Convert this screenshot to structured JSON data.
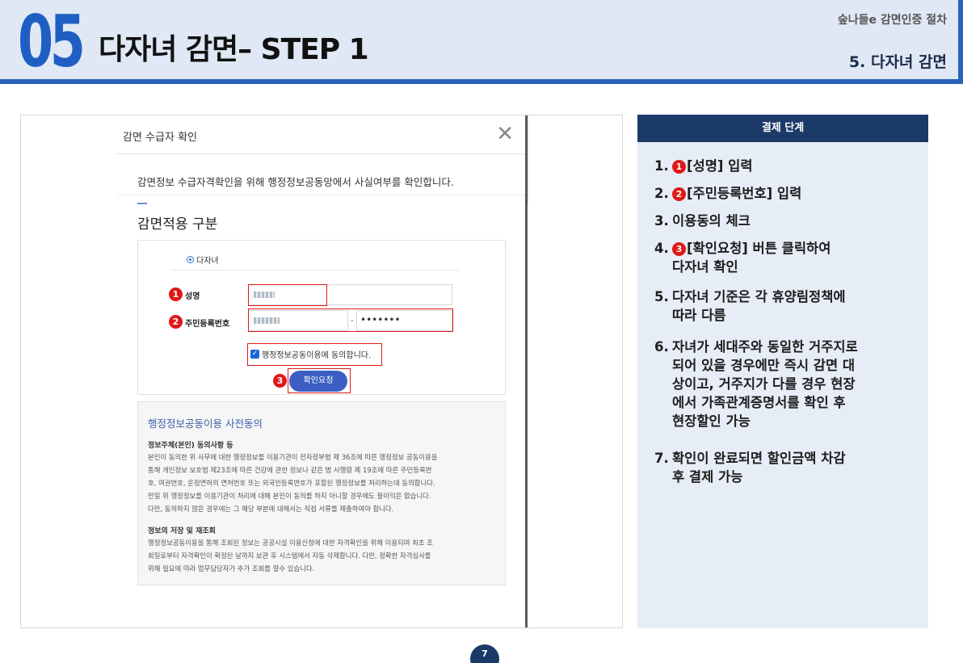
{
  "header": {
    "chapter_number": "05",
    "title": "다자녀 감면– STEP 1",
    "sub_title": "숲나들e 감면인증 절차",
    "section": "5. 다자녀 감면"
  },
  "modal": {
    "title": "감면 수급자 확인",
    "close_symbol": "✕",
    "description": "감면정보 수급자격확인을 위해 행정정보공동망에서 사실여부를 확인합니다.",
    "section_title": "감면적용 구분",
    "radio_option": "다자녀",
    "fields": {
      "name_label": "성명",
      "rrn_label": "주민등록번호",
      "rrn_separator": "-",
      "rrn_back": "•••••••"
    },
    "badges": [
      "1",
      "2",
      "3"
    ],
    "agree_label": "행정정보공동이용에 동의합니다.",
    "confirm_button": "확인요청",
    "consent": {
      "title": "행정정보공동이용 사전동의",
      "sub1": "정보주체(본인) 동의사항 등",
      "text1": "본인이 동의한 위 사무에 대한 행정정보를 이용기관이 전자정부법 제 36조에 따른 행정정보 공동이용을\n통해 개인정보 보호법 제23조에 따른 건강에 관한 정보나 같은 법 시행령 제 19조에 따른 주민등록번\n호, 여권번호, 운정면허의 면허번호 또는 외국인등록번호가 포함된 행정정보를 처리하는데 동의합니다.\n만일 위 행정정보를 이용기관이 처리에 대해 본인이 동의를 하지 아니할 경우에도 불이익은 없습니다.\n다만, 동의하지 않은 경우에는 그 해당 부분에 대해서는 직접 서류를 제출하여야 합니다.",
      "sub2": "정보의 저장 및 재조회",
      "text2": "행정정보공동이용을 통해 조회된 정보는 공공시설 이용신청에 대한 자격확인을 위해 이용되며 최초 조\n회일로부터 자격확인이 확정된 날까지 보관 후 시스템에서 자동 삭제합니다. 다만, 정확한 자격심사를\n위해 필요에 따라 업무담당자가 추가 조회를 할수 있습니다."
    }
  },
  "panel": {
    "header": "결제 단계",
    "steps": [
      {
        "num": "1.",
        "badge": "1",
        "text": "[성명] 입력",
        "cont": ""
      },
      {
        "num": "2.",
        "badge": "2",
        "text": "[주민등록번호] 입력",
        "cont": ""
      },
      {
        "num": "3.",
        "badge": "",
        "text": "이용동의 체크",
        "cont": ""
      },
      {
        "num": "4.",
        "badge": "3",
        "text": "[확인요청] 버튼 클릭하여",
        "cont": "다자녀 확인"
      },
      {
        "num": "5.",
        "badge": "",
        "text": "다자녀 기준은 각 휴양림정책에",
        "cont": "따라 다름"
      },
      {
        "num": "6.",
        "badge": "",
        "text": "자녀가 세대주와 동일한 거주지로",
        "cont": "되어 있을 경우에만 즉시 감면 대\n상이고, 거주지가 다를 경우 현장\n에서 가족관계증명서를 확인 후\n현장할인 가능"
      },
      {
        "num": "7.",
        "badge": "",
        "text": "확인이 완료되면 할인금액 차감",
        "cont": "후 결제 가능"
      }
    ]
  },
  "page_number": "7",
  "colors": {
    "header_bg": "#dfe8f4",
    "accent_blue": "#2a62b8",
    "navy": "#1c3a68",
    "badge_red": "#e01818",
    "panel_bg": "#e6edf6"
  }
}
